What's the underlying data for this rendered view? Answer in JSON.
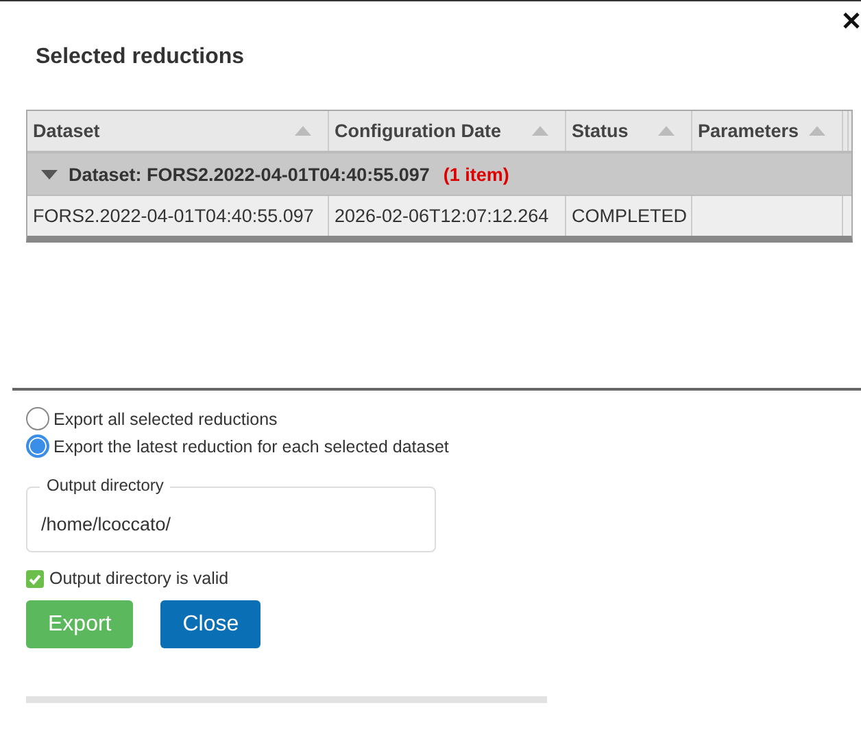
{
  "dialog": {
    "title": "Selected reductions"
  },
  "table": {
    "columns": [
      {
        "label": "Dataset",
        "sort_ascending": true
      },
      {
        "label": "Configuration Date",
        "sort_ascending": true
      },
      {
        "label": "Status",
        "sort_ascending": true
      },
      {
        "label": "Parameters",
        "sort_ascending": true
      }
    ],
    "groups": [
      {
        "label": "Dataset: FORS2.2022-04-01T04:40:55.097",
        "count": "(1 item)",
        "expanded": true,
        "rows": [
          {
            "cells": [
              "FORS2.2022-04-01T04:40:55.097",
              "2026-02-06T12:07:12.264",
              "COMPLETED",
              ""
            ]
          }
        ]
      }
    ]
  },
  "export_options": [
    {
      "label": "Export all selected reductions",
      "selected": false
    },
    {
      "label": "Export the latest reduction for each selected dataset",
      "selected": true
    }
  ],
  "output_directory": {
    "label": "Output directory",
    "value": "/home/lcoccato/"
  },
  "validation": {
    "valid": true,
    "message": "Output directory is valid"
  },
  "buttons": [
    {
      "label": "Export",
      "kind": "primary"
    },
    {
      "label": "Close",
      "kind": "secondary"
    }
  ]
}
